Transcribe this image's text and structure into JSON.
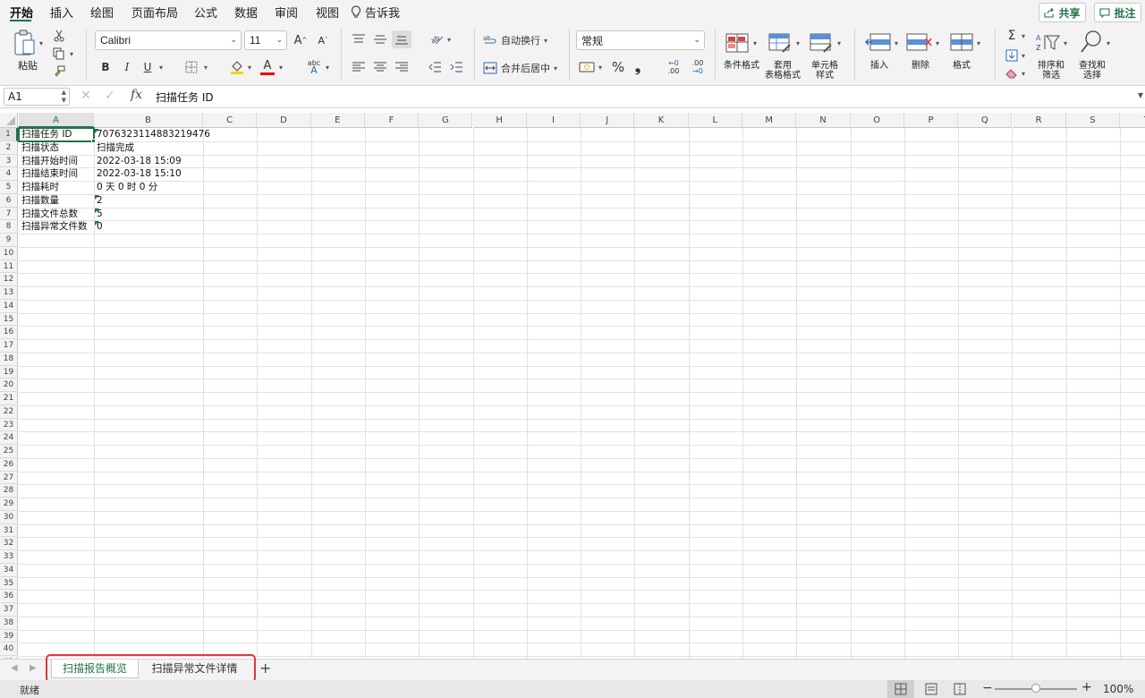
{
  "menu": {
    "tabs": [
      "开始",
      "插入",
      "绘图",
      "页面布局",
      "公式",
      "数据",
      "审阅",
      "视图"
    ],
    "tell_me": "告诉我",
    "share": "共享",
    "comment": "批注"
  },
  "ribbon": {
    "paste": "粘贴",
    "font_name": "Calibri",
    "font_size": "11",
    "grow_font": "A",
    "shrink_font": "A",
    "bold": "B",
    "italic": "I",
    "underline": "U",
    "font_color_glyph": "A",
    "phonetic_glyph": "abc",
    "wrap_text": "自动换行",
    "merge_center": "合并后居中",
    "number_format": "常规",
    "percent": "%",
    "comma": "❟",
    "increase_decimal": ".00",
    "decrease_decimal": ".00",
    "conditional_format": "条件格式",
    "table_format_1": "套用",
    "table_format_2": "表格格式",
    "cell_style_1": "单元格",
    "cell_style_2": "样式",
    "insert": "插入",
    "delete": "删除",
    "format": "格式",
    "sort_filter_1": "排序和",
    "sort_filter_2": "筛选",
    "find_select_1": "查找和",
    "find_select_2": "选择"
  },
  "formula_bar": {
    "name_box": "A1",
    "fx": "fx",
    "content": "扫描任务 ID"
  },
  "grid": {
    "columns": [
      "A",
      "B",
      "C",
      "D",
      "E",
      "F",
      "G",
      "H",
      "I",
      "J",
      "K",
      "L",
      "M",
      "N",
      "O",
      "P",
      "Q",
      "R",
      "S",
      "T"
    ],
    "row_count": 41,
    "rows": [
      [
        "扫描任务 ID",
        "7076323114883219476"
      ],
      [
        "扫描状态",
        "扫描完成"
      ],
      [
        "扫描开始时间",
        "2022-03-18 15:09"
      ],
      [
        "扫描结束时间",
        "2022-03-18 15:10"
      ],
      [
        "扫描耗时",
        "0 天 0 时 0 分"
      ],
      [
        "扫描数量",
        "2"
      ],
      [
        "扫描文件总数",
        "5"
      ],
      [
        "扫描异常文件数",
        "0"
      ]
    ]
  },
  "sheets": {
    "tabs": [
      "扫描报告概览",
      "扫描异常文件详情"
    ],
    "add": "+"
  },
  "status": {
    "ready": "就绪",
    "zoom": "100%"
  },
  "colors": {
    "accent": "#217346",
    "highlight_box": "#e53935"
  }
}
